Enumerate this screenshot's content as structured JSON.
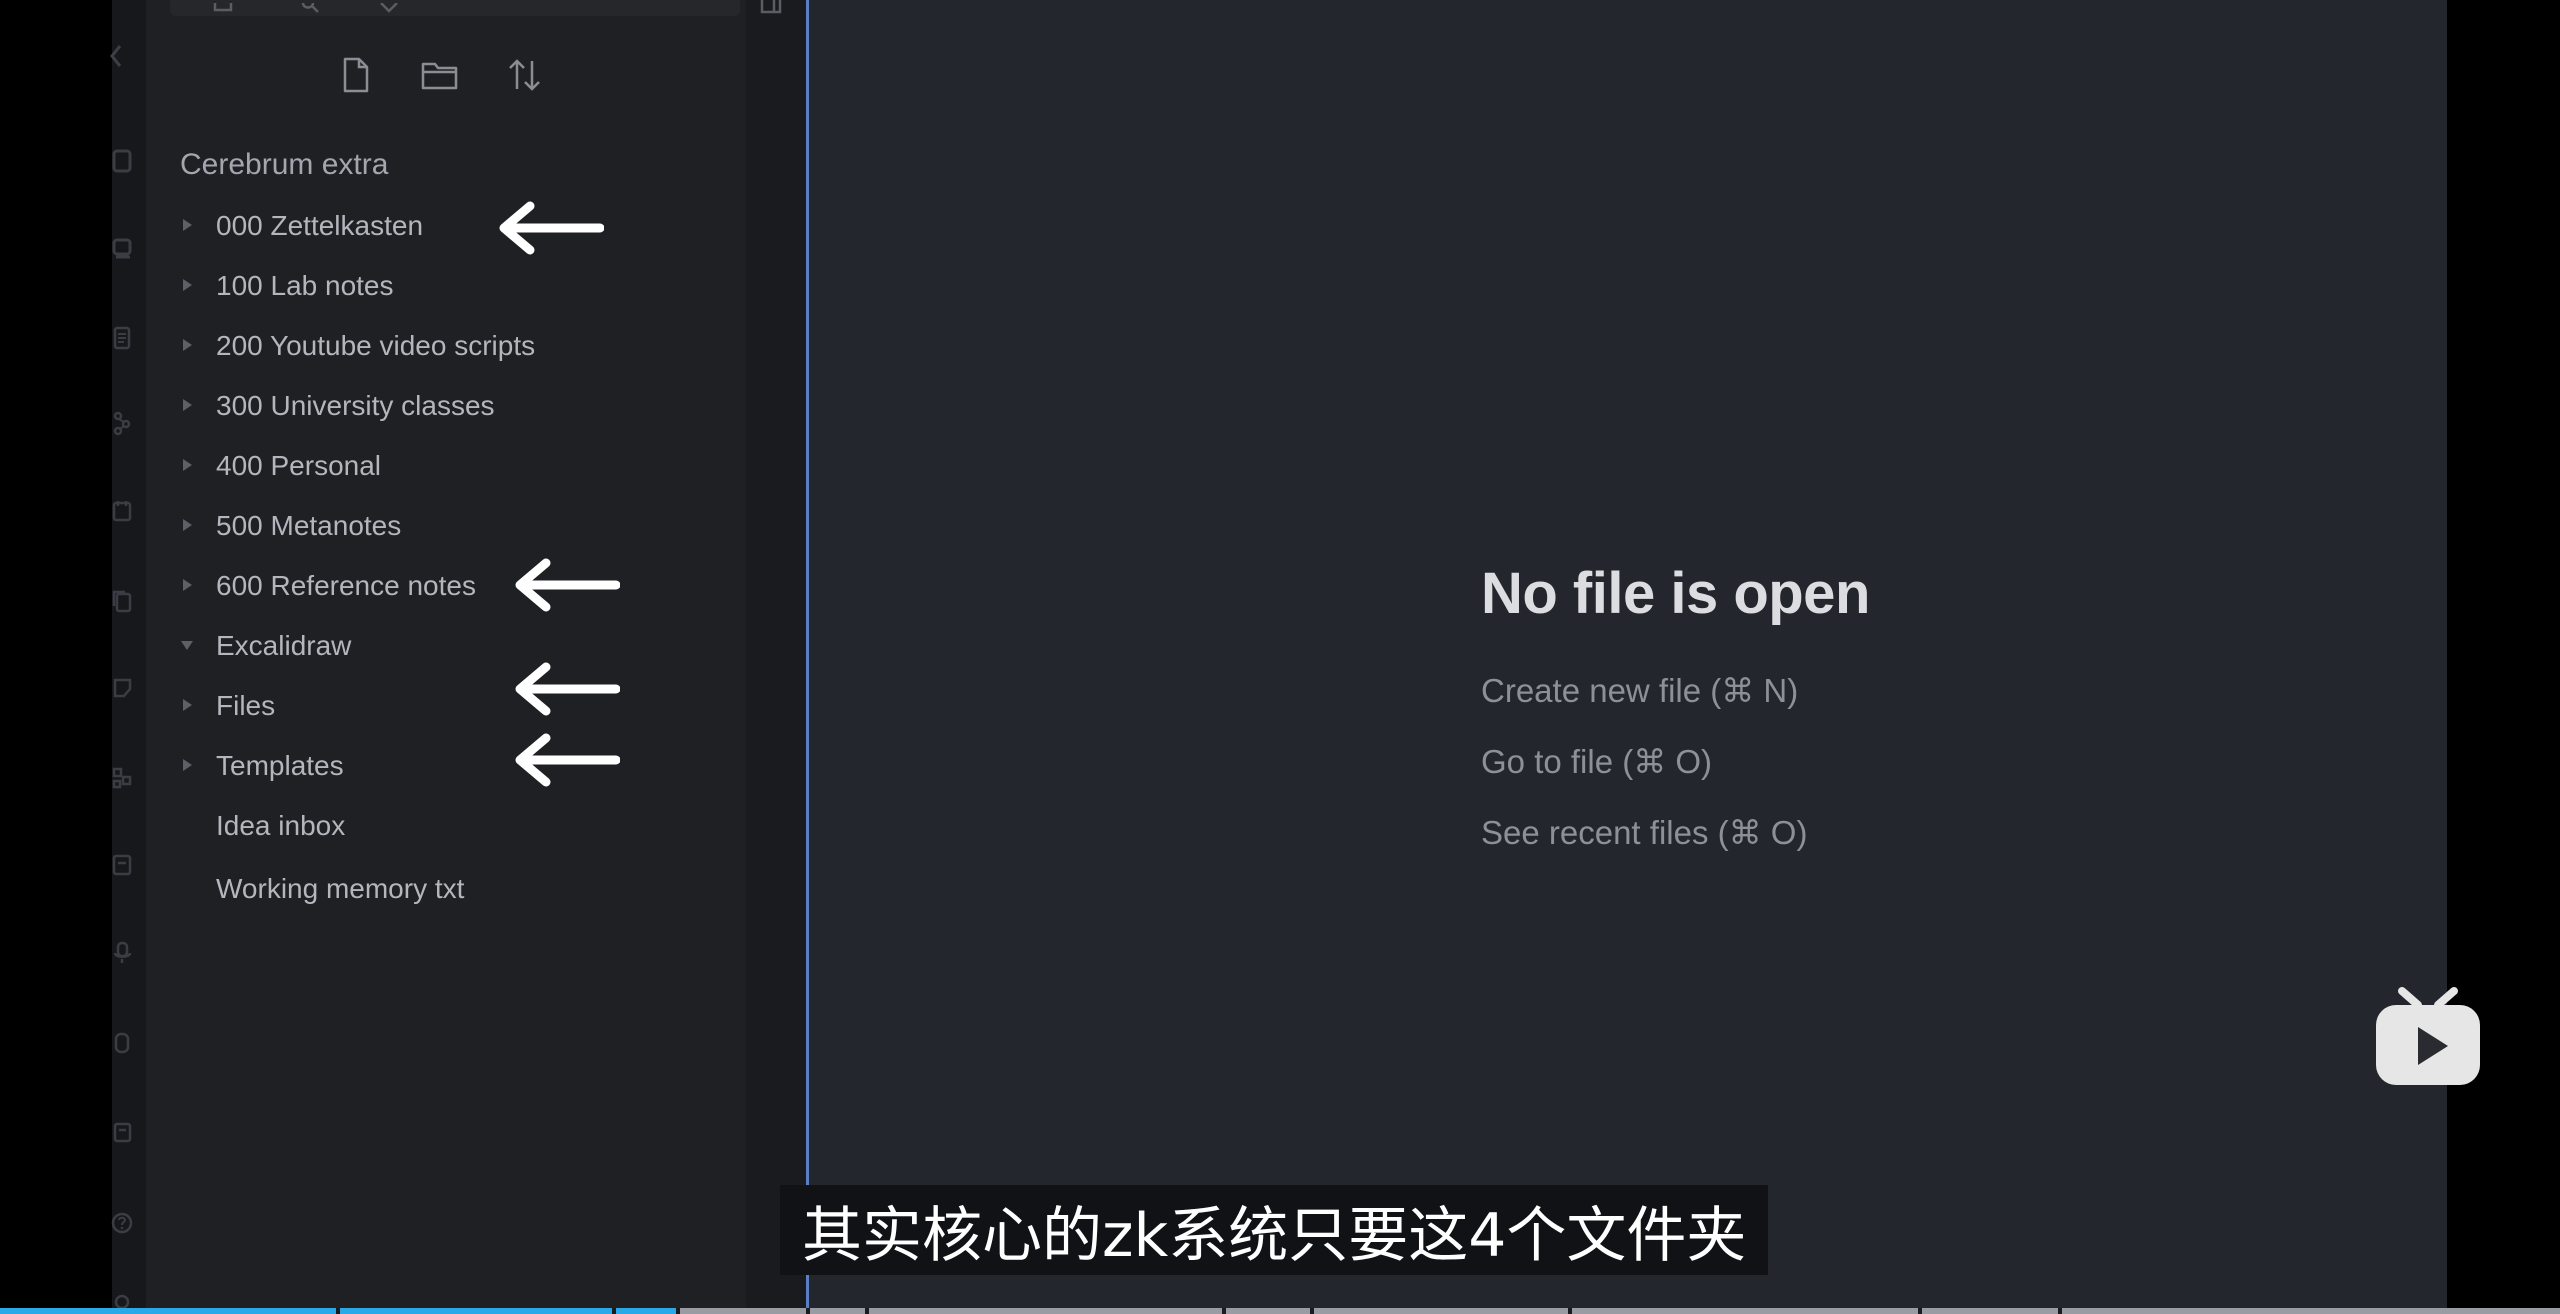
{
  "sidebar": {
    "vault_name": "Cerebrum extra",
    "actions": [
      {
        "name": "new-note",
        "icon": "file-plus-icon"
      },
      {
        "name": "new-folder",
        "icon": "folder-plus-icon"
      },
      {
        "name": "sort",
        "icon": "sort-icon"
      }
    ],
    "tree": [
      {
        "label": "000 Zettelkasten",
        "type": "folder",
        "expanded": false
      },
      {
        "label": "100 Lab notes",
        "type": "folder",
        "expanded": false
      },
      {
        "label": "200 Youtube video scripts",
        "type": "folder",
        "expanded": false
      },
      {
        "label": "300 University classes",
        "type": "folder",
        "expanded": false
      },
      {
        "label": "400 Personal",
        "type": "folder",
        "expanded": false
      },
      {
        "label": "500 Metanotes",
        "type": "folder",
        "expanded": false
      },
      {
        "label": "600 Reference notes",
        "type": "folder",
        "expanded": false
      },
      {
        "label": "Excalidraw",
        "type": "folder",
        "expanded": true
      },
      {
        "label": "Files",
        "type": "folder",
        "expanded": false
      },
      {
        "label": "Templates",
        "type": "folder",
        "expanded": false
      },
      {
        "label": "Idea inbox",
        "type": "file"
      },
      {
        "label": "Working memory txt",
        "type": "file"
      }
    ]
  },
  "main": {
    "empty_title": "No file is open",
    "actions": [
      "Create new file (⌘ N)",
      "Go to file (⌘ O)",
      "See recent files (⌘ O)"
    ]
  },
  "video": {
    "subtitle": "其实核心的zk系统只要这4个文件夹",
    "progress": 0.265
  },
  "colors": {
    "accent": "#5b7fc4",
    "progress": "#29a9e8",
    "annotation_arrow": "#ffffff"
  }
}
